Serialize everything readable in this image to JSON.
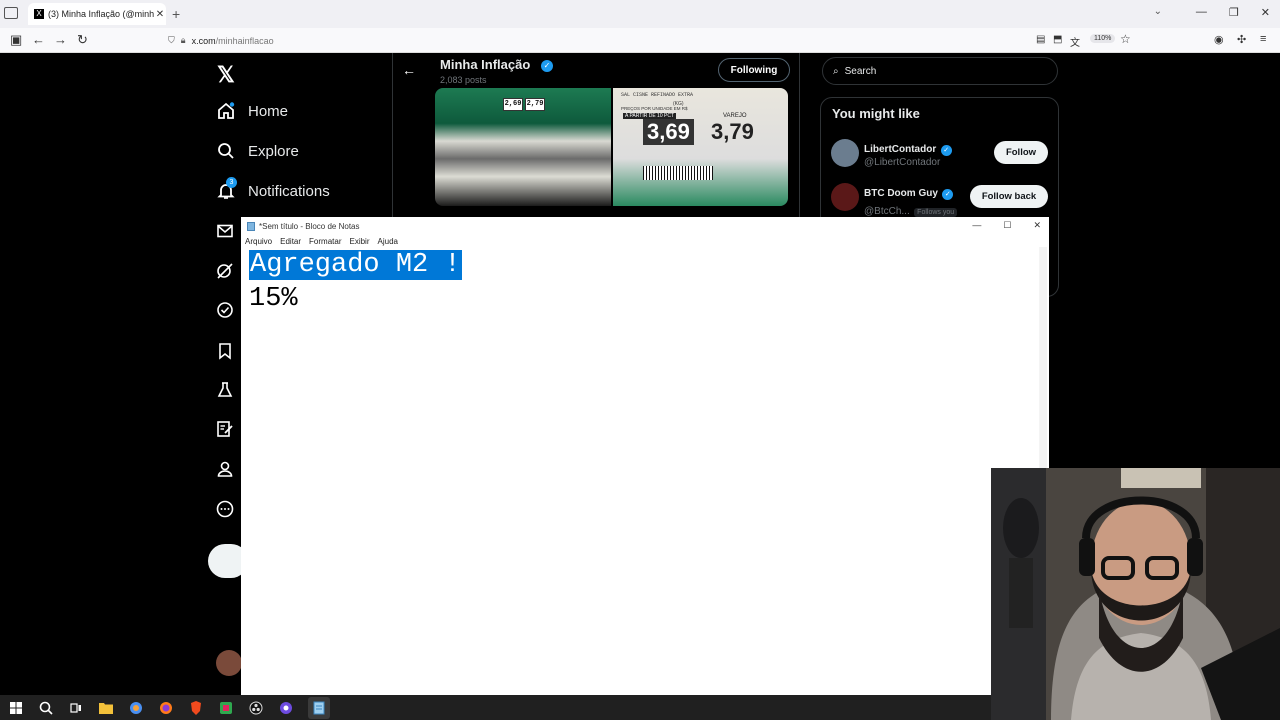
{
  "browser": {
    "tab_title": "(3) Minha Inflação (@minhainfl…",
    "url_host": "x.com",
    "url_path": "/minhainflacao",
    "zoom": "110%"
  },
  "sidebar": {
    "items": [
      {
        "label": "Home",
        "icon": "home-icon"
      },
      {
        "label": "Explore",
        "icon": "search-icon"
      },
      {
        "label": "Notifications",
        "icon": "bell-icon",
        "badge": "3"
      }
    ],
    "icons_only": [
      "mail-icon",
      "grok-icon",
      "verified-icon",
      "bookmark-icon",
      "flask-icon",
      "edit-list-icon",
      "profile-icon",
      "more-icon"
    ]
  },
  "profile": {
    "name": "Minha Inflação",
    "posts": "2,083 posts",
    "following_label": "Following",
    "media_prices": {
      "left_a": "2,69",
      "left_b": "2,79",
      "right_header": "SAL CISNE REFINADO EXTRA",
      "right_unit": "(KG)",
      "right_sub": "PREÇOS POR UNIDADE EM R$",
      "right_promo": "A PARTIR DE 10 PCT",
      "right_varejo": "VAREJO",
      "right_price1": "3,69",
      "right_price2": "3,79"
    }
  },
  "right_column": {
    "search_placeholder": "Search",
    "wtf_title": "You might like",
    "accounts": [
      {
        "name": "LibertContador",
        "handle": "@LibertContador",
        "button": "Follow"
      },
      {
        "name": "BTC Doom Guy",
        "handle": "@BtcCh...",
        "follows_you": "Follows you",
        "button": "Follow back"
      }
    ]
  },
  "notepad": {
    "title": "*Sem título - Bloco de Notas",
    "menu": [
      "Arquivo",
      "Editar",
      "Formatar",
      "Exibir",
      "Ajuda"
    ],
    "line1": "Agregado M2 !",
    "line2": "15%"
  }
}
